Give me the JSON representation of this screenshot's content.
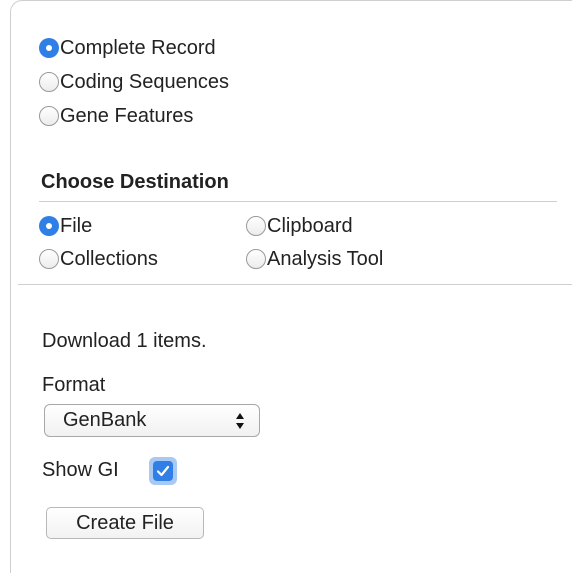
{
  "record_options": [
    {
      "label": "Complete Record",
      "checked": true
    },
    {
      "label": "Coding Sequences",
      "checked": false
    },
    {
      "label": "Gene Features",
      "checked": false
    }
  ],
  "destination": {
    "title": "Choose Destination",
    "options": [
      {
        "label": "File",
        "checked": true
      },
      {
        "label": "Clipboard",
        "checked": false
      },
      {
        "label": "Collections",
        "checked": false
      },
      {
        "label": "Analysis Tool",
        "checked": false
      }
    ]
  },
  "download": {
    "summary": "Download 1 items.",
    "format_label": "Format",
    "format_value": "GenBank",
    "show_gi_label": "Show GI",
    "show_gi_checked": true,
    "create_button": "Create File"
  },
  "colors": {
    "accent": "#2f7fe6",
    "divider": "#cfcfcf"
  }
}
